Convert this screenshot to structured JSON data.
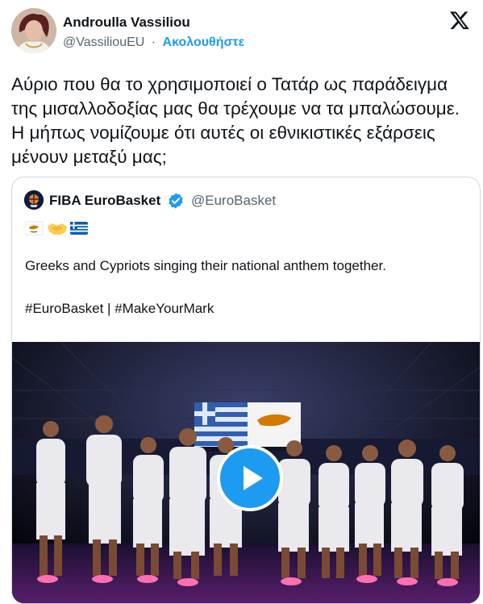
{
  "author": {
    "name": "Androulla Vassiliou",
    "handle": "@VassiliouEU",
    "separator": "·",
    "follow_label": "Ακολουθήστε"
  },
  "tweet": {
    "text": "Αύριο που θα το χρησιμοποιεί ο Τατάρ ως παράδειγμα της μισαλλοδοξίας μας θα τρέχουμε να τα μπαλώσουμε. Η μήπως νομίζουμε ότι αυτές οι εθνικιστικές εξάρσεις μένουν μεταξύ μας;"
  },
  "quoted": {
    "name": "FIBA EuroBasket",
    "handle": "@EuroBasket",
    "emojis": [
      "cyprus-flag-icon",
      "handshake-icon",
      "greece-flag-icon"
    ],
    "text": "Greeks and Cypriots singing their national anthem together.",
    "hashtags": "#EuroBasket | #MakeYourMark"
  },
  "colors": {
    "accent": "#1d9bf0",
    "text": "#0f1419",
    "secondary": "#536471",
    "border": "#cfd9de"
  }
}
